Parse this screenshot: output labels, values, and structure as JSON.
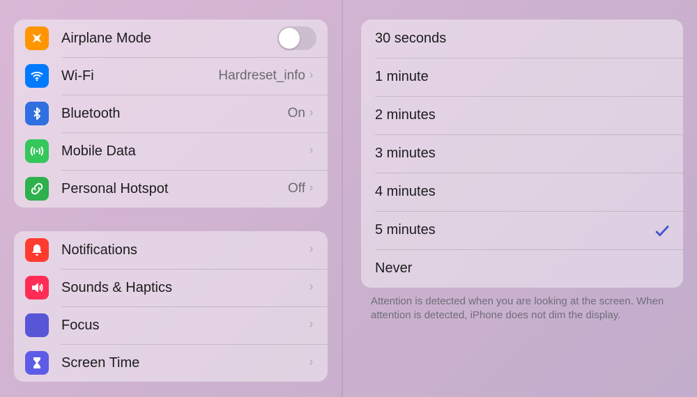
{
  "sidebar": {
    "group1": [
      {
        "id": "airplane",
        "label": "Airplane Mode",
        "value": "",
        "toggle": true,
        "icon": "airplane-icon",
        "color": "ic-orange"
      },
      {
        "id": "wifi",
        "label": "Wi-Fi",
        "value": "Hardreset_info",
        "chevron": true,
        "icon": "wifi-icon",
        "color": "ic-blue"
      },
      {
        "id": "bluetooth",
        "label": "Bluetooth",
        "value": "On",
        "chevron": true,
        "icon": "bluetooth-icon",
        "color": "ic-blue2"
      },
      {
        "id": "mobile",
        "label": "Mobile Data",
        "value": "",
        "chevron": true,
        "icon": "antenna-icon",
        "color": "ic-green"
      },
      {
        "id": "hotspot",
        "label": "Personal Hotspot",
        "value": "Off",
        "chevron": true,
        "icon": "link-icon",
        "color": "ic-green2"
      }
    ],
    "group2": [
      {
        "id": "notifications",
        "label": "Notifications",
        "chevron": true,
        "icon": "bell-icon",
        "color": "ic-red"
      },
      {
        "id": "sounds",
        "label": "Sounds & Haptics",
        "chevron": true,
        "icon": "speaker-icon",
        "color": "ic-pink"
      },
      {
        "id": "focus",
        "label": "Focus",
        "chevron": true,
        "icon": "moon-icon",
        "color": "ic-indigo"
      },
      {
        "id": "screentime",
        "label": "Screen Time",
        "chevron": true,
        "icon": "hourglass-icon",
        "color": "ic-violet"
      }
    ]
  },
  "detail": {
    "options": [
      {
        "label": "30 seconds",
        "selected": false
      },
      {
        "label": "1 minute",
        "selected": false
      },
      {
        "label": "2 minutes",
        "selected": false
      },
      {
        "label": "3 minutes",
        "selected": false
      },
      {
        "label": "4 minutes",
        "selected": false
      },
      {
        "label": "5 minutes",
        "selected": true
      },
      {
        "label": "Never",
        "selected": false
      }
    ],
    "footer": "Attention is detected when you are looking at the screen. When attention is detected, iPhone does not dim the display."
  }
}
